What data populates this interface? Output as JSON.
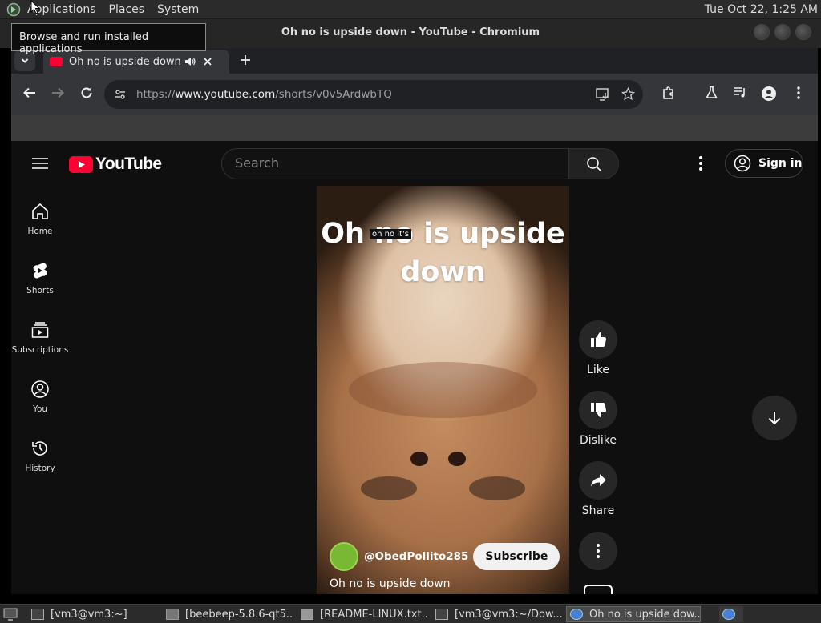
{
  "desktop": {
    "menu": [
      "Applications",
      "Places",
      "System"
    ],
    "clock": "Tue Oct 22,  1:25 AM",
    "tooltip": "Browse and run installed applications"
  },
  "window": {
    "title": "Oh no is upside down - YouTube - Chromium"
  },
  "browser": {
    "tab_title": "Oh no is upside down - YouTube",
    "url_prefix": "https://",
    "url_domain": "www.youtube.com",
    "url_path": "/shorts/v0v5ArdwbTQ"
  },
  "youtube": {
    "logo_text": "YouTube",
    "search_placeholder": "Search",
    "sign_in": "Sign in",
    "nav": [
      {
        "label": "Home",
        "icon": "home-icon"
      },
      {
        "label": "Shorts",
        "icon": "shorts-icon"
      },
      {
        "label": "Subscriptions",
        "icon": "subscriptions-icon"
      },
      {
        "label": "You",
        "icon": "you-icon"
      },
      {
        "label": "History",
        "icon": "history-icon"
      }
    ],
    "short": {
      "overlay_title": "Oh no is upside down",
      "caption": "oh no it's",
      "channel": "@ObedPollito285",
      "subscribe": "Subscribe",
      "description": "Oh no is upside down"
    },
    "actions": {
      "like": "Like",
      "dislike": "Dislike",
      "share": "Share"
    }
  },
  "taskbar": [
    {
      "label": "[vm3@vm3:~]"
    },
    {
      "label": "[beebeep-5.8.6-qt5..."
    },
    {
      "label": "[README-LINUX.txt..."
    },
    {
      "label": "[vm3@vm3:~/Dow..."
    },
    {
      "label": "Oh no is upside dow..."
    }
  ],
  "colors": {
    "youtube_red": "#ff0033",
    "bg": "#0f0f0f",
    "chrome_toolbar": "#35363a"
  }
}
